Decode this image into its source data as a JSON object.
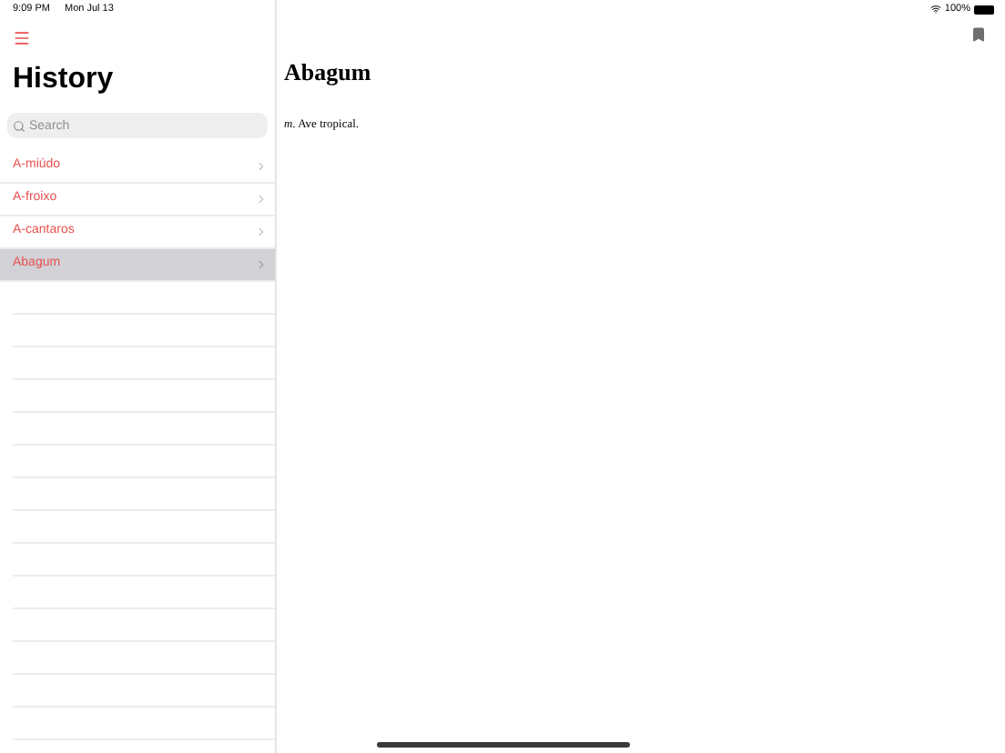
{
  "status_bar": {
    "time": "9:09 PM",
    "date": "Mon Jul 13",
    "battery": "100%"
  },
  "sidebar": {
    "title": "History",
    "search": {
      "placeholder": "Search"
    },
    "items": [
      {
        "label": "A-miúdo",
        "selected": false
      },
      {
        "label": "A-froixo",
        "selected": false
      },
      {
        "label": "A-cantaros",
        "selected": false
      },
      {
        "label": "Abagum",
        "selected": true
      }
    ]
  },
  "entry": {
    "headword": "Abagum",
    "definition": "*m.* Ave tropical."
  }
}
